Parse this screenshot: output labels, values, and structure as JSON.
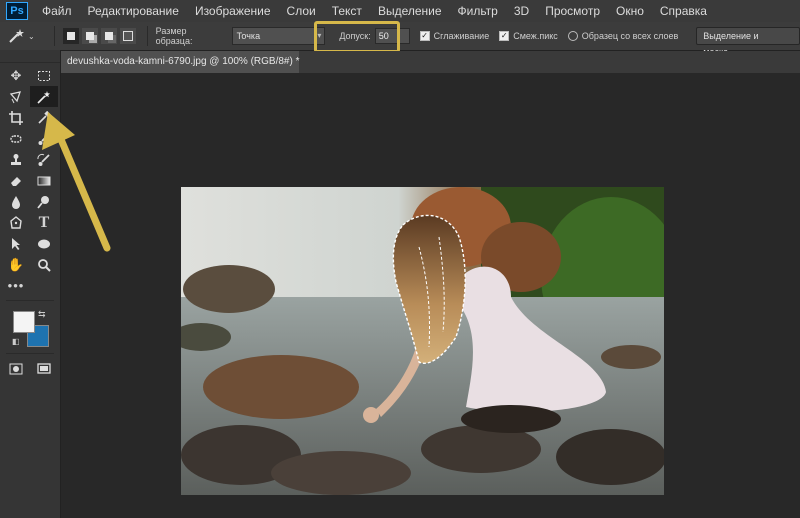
{
  "app": {
    "logo": "Ps"
  },
  "menu": [
    "Файл",
    "Редактирование",
    "Изображение",
    "Слои",
    "Текст",
    "Выделение",
    "Фильтр",
    "3D",
    "Просмотр",
    "Окно",
    "Справка"
  ],
  "options": {
    "sample_size_label": "Размер образца:",
    "sample_size_value": "Точка",
    "tolerance_label": "Допуск:",
    "tolerance_value": "50",
    "anti_alias_label": "Сглаживание",
    "contiguous_label": "Смеж.пикс",
    "sample_all_layers_label": "Образец со всех слоев",
    "select_mask_button": "Выделение и маска..."
  },
  "document": {
    "tab_title": "devushka-voda-kamni-6790.jpg @ 100% (RGB/8#) *"
  },
  "colors": {
    "foreground": "#f4f4f4",
    "background": "#1e73b0",
    "annotation": "#d6b84a"
  },
  "tools": [
    "move-icon",
    "marquee-icon",
    "lasso-icon",
    "magic-wand-icon",
    "crop-icon",
    "eyedropper-icon",
    "healing-icon",
    "brush-icon",
    "stamp-icon",
    "history-brush-icon",
    "eraser-icon",
    "gradient-icon",
    "blur-icon",
    "dodge-icon",
    "pen-icon",
    "type-icon",
    "path-select-icon",
    "ellipse-icon",
    "hand-icon",
    "zoom-icon",
    "more-icon"
  ]
}
